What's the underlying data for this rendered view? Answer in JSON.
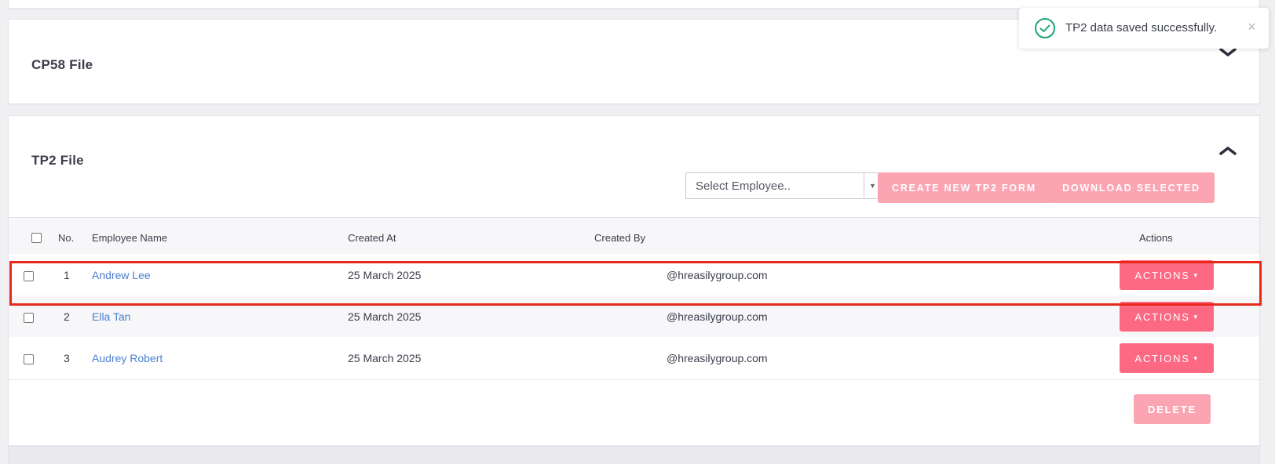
{
  "sections": {
    "cp58": {
      "title": "CP58 File",
      "expanded": false
    },
    "tp2": {
      "title": "TP2 File",
      "expanded": true
    }
  },
  "tp2": {
    "select_placeholder": "Select Employee..",
    "create_button": "CREATE NEW TP2 FORM",
    "download_button": "DOWNLOAD SELECTED",
    "delete_button": "DELETE",
    "columns": {
      "no": "No.",
      "employee_name": "Employee Name",
      "created_at": "Created At",
      "created_by": "Created By",
      "actions": "Actions"
    },
    "rows": [
      {
        "no": "1",
        "name": "Andrew Lee",
        "created_at": "25 March 2025",
        "created_by": "@hreasilygroup.com",
        "action": "ACTIONS"
      },
      {
        "no": "2",
        "name": "Ella Tan",
        "created_at": "25 March 2025",
        "created_by": "@hreasilygroup.com",
        "action": "ACTIONS"
      },
      {
        "no": "3",
        "name": "Audrey Robert",
        "created_at": "25 March 2025",
        "created_by": "@hreasilygroup.com",
        "action": "ACTIONS"
      }
    ]
  },
  "toast": {
    "message": "TP2 data saved successfully.",
    "icon": "check-circle-icon",
    "close": "×"
  },
  "colors": {
    "accent_pink": "#fd6883",
    "disabled_pink": "#fba5b3",
    "link_blue": "#4c7fcf",
    "success_green": "#1ea672",
    "highlight_red": "#e8281b"
  }
}
